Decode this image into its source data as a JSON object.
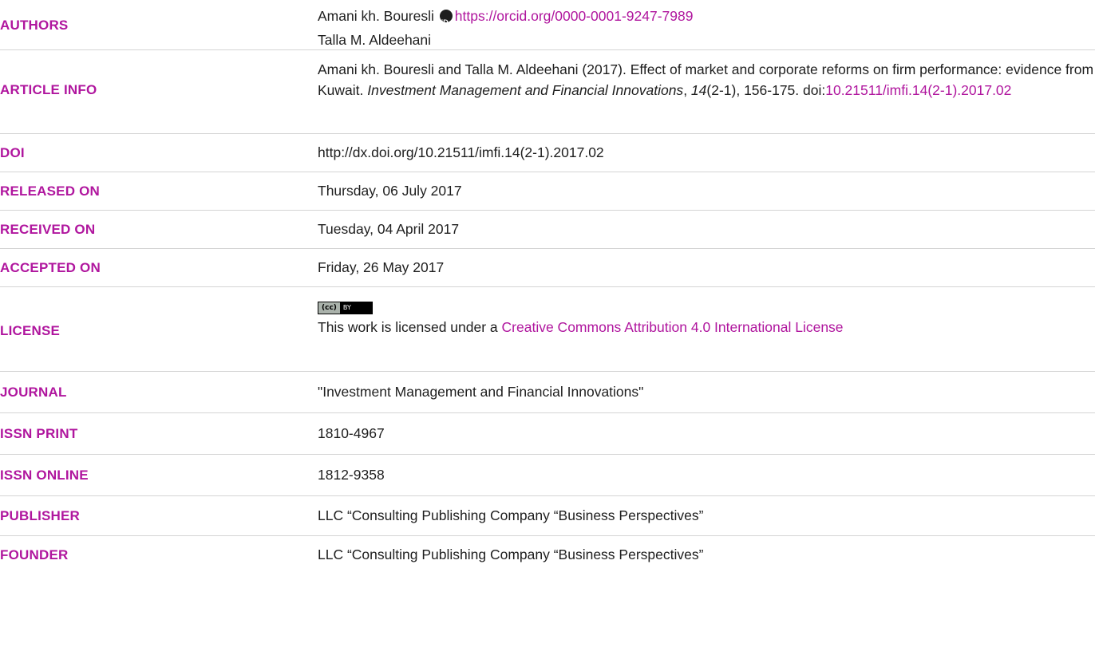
{
  "rows": {
    "authors": {
      "label": "AUTHORS",
      "author1": "Amani kh. Bouresli",
      "orcid_url": "https://orcid.org/0000-0001-9247-7989",
      "author2": "Talla M. Aldeehani"
    },
    "article_info": {
      "label": "ARTICLE INFO",
      "citation_prefix": "Amani kh. Bouresli and Talla M. Aldeehani (2017). Effect of market and corporate reforms on firm performance: evidence from Kuwait. ",
      "journal_italic": "Investment Management and Financial Innovations",
      "sep1": ", ",
      "volume_italic": "14",
      "pages": "(2-1), 156-175. doi:",
      "doi_link": "10.21511/imfi.14(2-1).2017.02"
    },
    "doi": {
      "label": "DOI",
      "value": "http://dx.doi.org/10.21511/imfi.14(2-1).2017.02"
    },
    "released_on": {
      "label": "RELEASED ON",
      "value": "Thursday, 06 July 2017"
    },
    "received_on": {
      "label": "RECEIVED ON",
      "value": "Tuesday, 04 April 2017"
    },
    "accepted_on": {
      "label": "ACCEPTED ON",
      "value": "Friday, 26 May 2017"
    },
    "license": {
      "label": "LICENSE",
      "badge_left": "(cc)",
      "badge_right": "BY",
      "text_prefix": "This work is licensed under a ",
      "link": "Creative Commons Attribution 4.0 International License"
    },
    "journal": {
      "label": "JOURNAL",
      "value": "\"Investment Management and Financial Innovations\""
    },
    "issn_print": {
      "label": "ISSN PRINT",
      "value": "1810-4967"
    },
    "issn_online": {
      "label": "ISSN ONLINE",
      "value": "1812-9358"
    },
    "publisher": {
      "label": "PUBLISHER",
      "value": "LLC “Consulting Publishing Company “Business Perspectives”"
    },
    "founder": {
      "label": "FOUNDER",
      "value": "LLC “Consulting Publishing Company “Business Perspectives”"
    }
  },
  "colors": {
    "accent": "#b0169e",
    "text": "#1e1e1e",
    "divider": "#d4d4d4"
  }
}
